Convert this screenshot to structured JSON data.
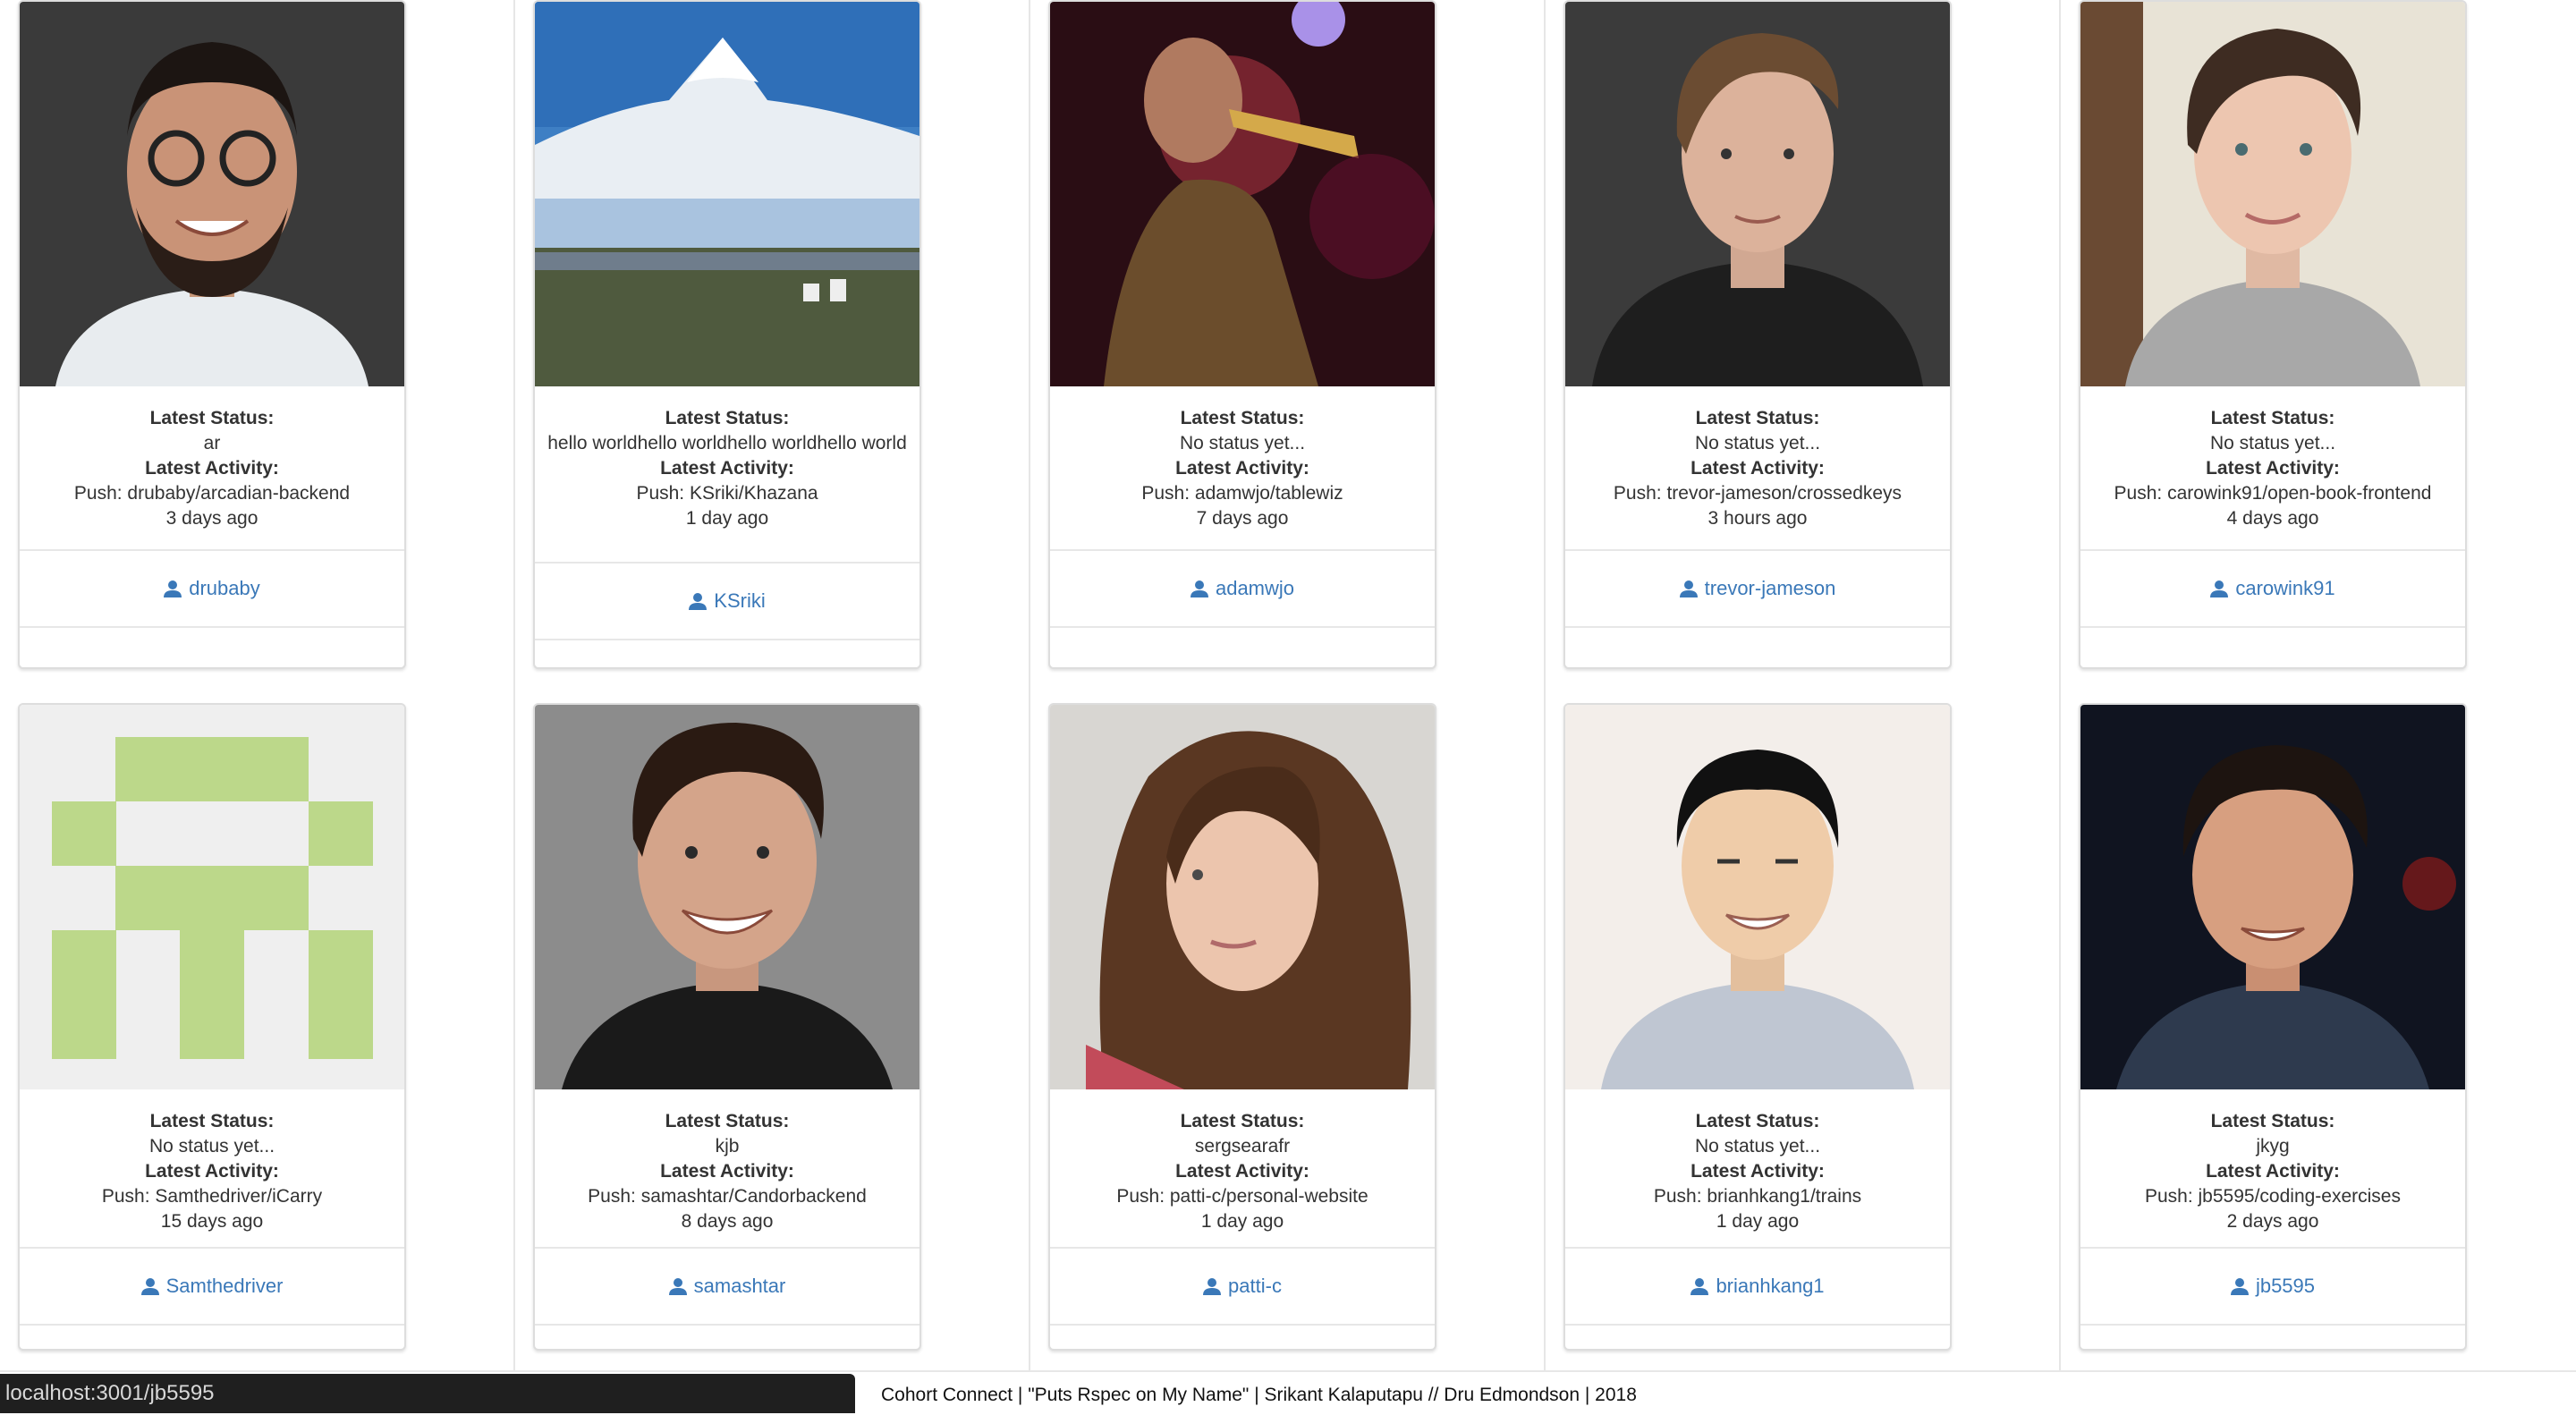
{
  "cards": [
    {
      "status_label": "Latest Status:",
      "status": "ar",
      "activity_label": "Latest Activity:",
      "activity": "Push: drubaby/arcadian-backend",
      "when": "3 days ago",
      "username": "drubaby",
      "photo": "man-glasses-beard"
    },
    {
      "status_label": "Latest Status:",
      "status": "hello worldhello worldhello worldhello world",
      "activity_label": "Latest Activity:",
      "activity": "Push: KSriki/Khazana",
      "when": "1 day ago",
      "username": "KSriki",
      "photo": "mountain-landscape"
    },
    {
      "status_label": "Latest Status:",
      "status": "No status yet...",
      "activity_label": "Latest Activity:",
      "activity": "Push: adamwjo/tablewiz",
      "when": "7 days ago",
      "username": "adamwjo",
      "photo": "trumpet-player"
    },
    {
      "status_label": "Latest Status:",
      "status": "No status yet...",
      "activity_label": "Latest Activity:",
      "activity": "Push: trevor-jameson/crossedkeys",
      "when": "3 hours ago",
      "username": "trevor-jameson",
      "photo": "man-jacket"
    },
    {
      "status_label": "Latest Status:",
      "status": "No status yet...",
      "activity_label": "Latest Activity:",
      "activity": "Push: carowink91/open-book-frontend",
      "when": "4 days ago",
      "username": "carowink91",
      "photo": "woman-short-hair"
    },
    {
      "status_label": "Latest Status:",
      "status": "No status yet...",
      "activity_label": "Latest Activity:",
      "activity": "Push: Samthedriver/iCarry",
      "when": "15 days ago",
      "username": "Samthedriver",
      "photo": "identicon"
    },
    {
      "status_label": "Latest Status:",
      "status": "kjb",
      "activity_label": "Latest Activity:",
      "activity": "Push: samashtar/Candorbackend",
      "when": "8 days ago",
      "username": "samashtar",
      "photo": "smiling-man"
    },
    {
      "status_label": "Latest Status:",
      "status": "sergsearafr",
      "activity_label": "Latest Activity:",
      "activity": "Push: patti-c/personal-website",
      "when": "1 day ago",
      "username": "patti-c",
      "photo": "person-long-hair"
    },
    {
      "status_label": "Latest Status:",
      "status": "No status yet...",
      "activity_label": "Latest Activity:",
      "activity": "Push: brianhkang1/trains",
      "when": "1 day ago",
      "username": "brianhkang1",
      "photo": "man-collared-shirt"
    },
    {
      "status_label": "Latest Status:",
      "status": "jkyg",
      "activity_label": "Latest Activity:",
      "activity": "Push: jb5595/coding-exercises",
      "when": "2 days ago",
      "username": "jb5595",
      "photo": "young-man-dark"
    }
  ],
  "status_bar_url": "localhost:3001/jb5595",
  "footer_text": "Cohort Connect | \"Puts Rspec on My Name\" | Srikant Kalaputapu // Dru Edmondson | 2018",
  "colors": {
    "link": "#3a78b8",
    "identicon": "#bcd88a"
  }
}
